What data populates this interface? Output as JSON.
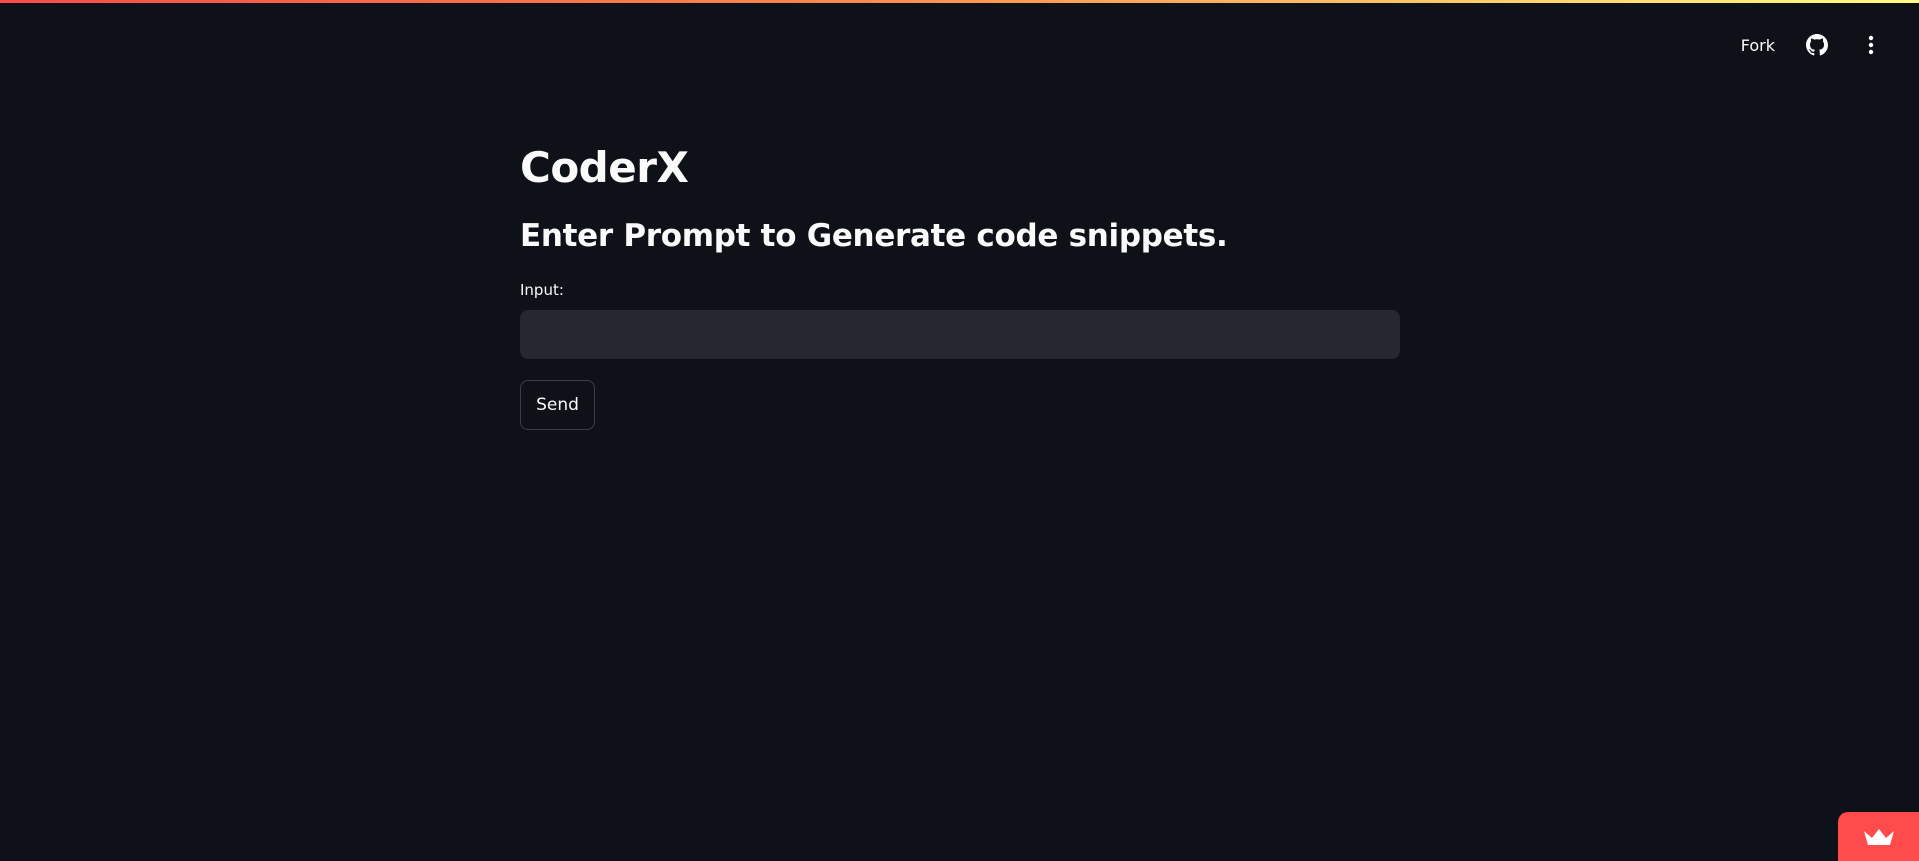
{
  "header": {
    "fork_label": "Fork",
    "github_icon": "github-icon",
    "menu_icon": "more-vertical-icon"
  },
  "main": {
    "title": "CoderX",
    "subtitle": "Enter Prompt to Generate code snippets.",
    "input_label": "Input:",
    "input_value": "",
    "send_label": "Send"
  },
  "badge": {
    "icon": "crown-icon"
  },
  "colors": {
    "background": "#0e1117",
    "input_background": "#262730",
    "accent": "#ff4b4b",
    "text": "#fafafa"
  }
}
